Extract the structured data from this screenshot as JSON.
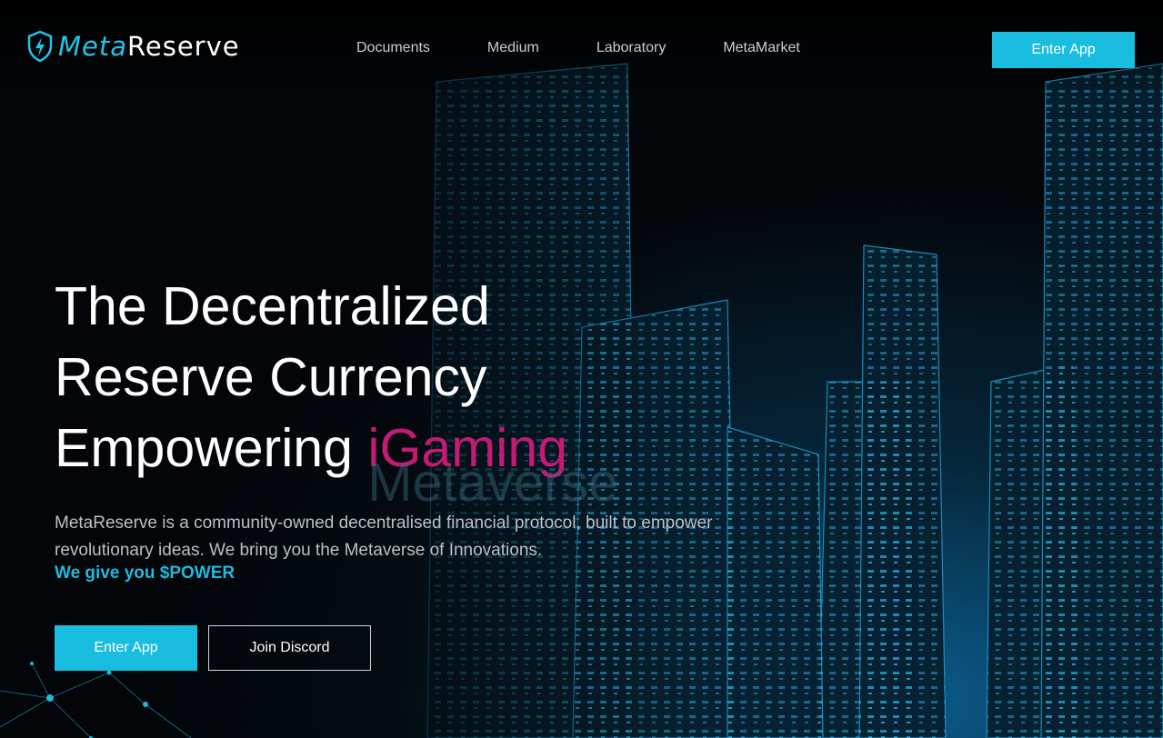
{
  "brand": {
    "name_part1": "Meta",
    "name_part2": "Reserve",
    "accent": "#22c4e6",
    "icon": "shield-lightning-icon"
  },
  "nav": {
    "items": [
      {
        "label": "Documents"
      },
      {
        "label": "Medium"
      },
      {
        "label": "Laboratory"
      },
      {
        "label": "MetaMarket"
      }
    ]
  },
  "header": {
    "cta_label": "Enter App"
  },
  "hero": {
    "line1": "The Decentralized",
    "line2": "Reserve Currency",
    "line3": "Empowering",
    "rotating_words": [
      "iGaming",
      "Metaverse"
    ],
    "highlight_color": "#c41a74",
    "description": "MetaReserve is a community-owned decentralised financial protocol, built to empower revolutionary ideas. We bring you the Metaverse of Innovations.",
    "tagline": "We give you $POWER",
    "primary_button": "Enter App",
    "secondary_button": "Join Discord"
  }
}
